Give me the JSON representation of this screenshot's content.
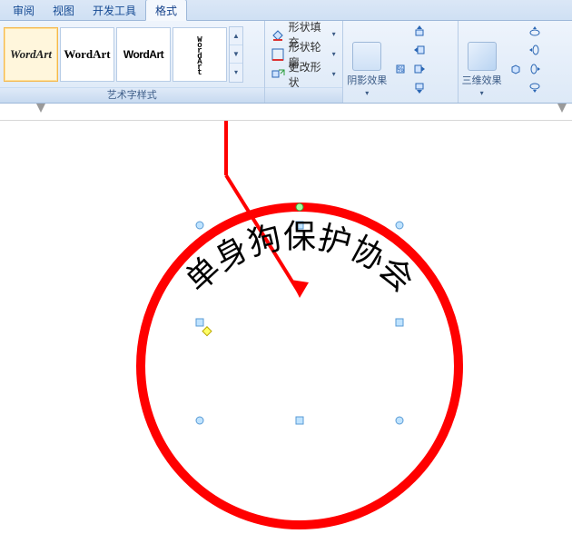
{
  "ribbon": {
    "tabs": {
      "t0": "审阅",
      "t1": "视图",
      "t2": "开发工具",
      "t3": "格式"
    },
    "active_index": 3,
    "groups": {
      "wordart": {
        "label": "艺术字样式",
        "items": {
          "i0": "WordArt",
          "i1": "WordArt",
          "i2": "WordArt",
          "i3": "WordArt",
          "i4": "w"
        }
      },
      "shape_menu": {
        "fill": "形状填充",
        "outline": "形状轮廓",
        "change": "更改形状"
      },
      "shadow": {
        "label": "阴影效果",
        "btn": "阴影效果"
      },
      "three_d": {
        "label": "三维效果",
        "btn": "三维效果"
      }
    }
  },
  "canvas": {
    "arc_text": "单身狗保护协会"
  }
}
